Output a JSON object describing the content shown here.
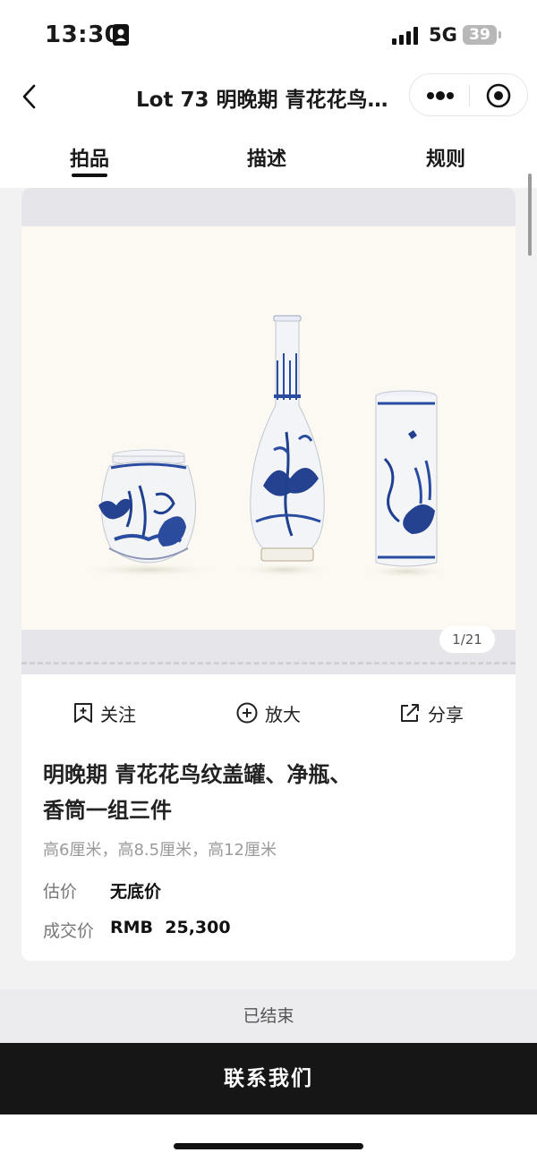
{
  "status_bar": {
    "time": "13:30",
    "network": "5G",
    "battery": "39"
  },
  "nav": {
    "title": "Lot 73 明晚期 青花花鸟…"
  },
  "tabs": [
    {
      "label": "拍品",
      "active": true
    },
    {
      "label": "描述",
      "active": false
    },
    {
      "label": "规则",
      "active": false
    }
  ],
  "gallery": {
    "page_indicator": "1/21",
    "image_description_icon": "porcelain-photo"
  },
  "actions": {
    "follow_label": "关注",
    "zoom_label": "放大",
    "share_label": "分享"
  },
  "lot": {
    "title_line1": "明晚期 青花花鸟纹盖罐、净瓶、",
    "title_line2": "香筒一组三件",
    "dimensions": "高6厘米，高8.5厘米，高12厘米",
    "estimate_label": "估价",
    "estimate_value": "无底价",
    "sold_label": "成交价",
    "sold_value": "RMB  25,300"
  },
  "footer": {
    "status": "已结束",
    "contact_label": "联系我们"
  },
  "colors": {
    "accent_dark": "#161616",
    "porcelain_blue": "#1f3f8f"
  }
}
